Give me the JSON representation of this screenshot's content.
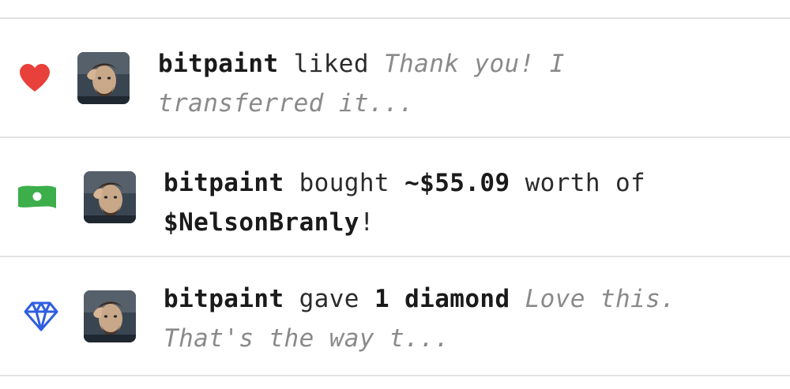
{
  "feed": {
    "items": [
      {
        "type": "like",
        "icon": "heart-icon",
        "icon_color": "#e8403a",
        "avatar": "user-avatar",
        "user": "bitpaint",
        "action": "liked",
        "preview": "Thank you! I transferred it..."
      },
      {
        "type": "purchase",
        "icon": "money-icon",
        "icon_color": "#3cae4a",
        "avatar": "user-avatar",
        "user": "bitpaint",
        "action": "bought",
        "amount": "~$55.09",
        "middle": "worth of",
        "coin": "$NelsonBranly",
        "suffix": "!"
      },
      {
        "type": "diamond",
        "icon": "diamond-icon",
        "icon_color": "#2f5fe0",
        "avatar": "user-avatar",
        "user": "bitpaint",
        "action": "gave",
        "gift": "1 diamond",
        "preview": "Love this. That's the way t..."
      }
    ]
  }
}
